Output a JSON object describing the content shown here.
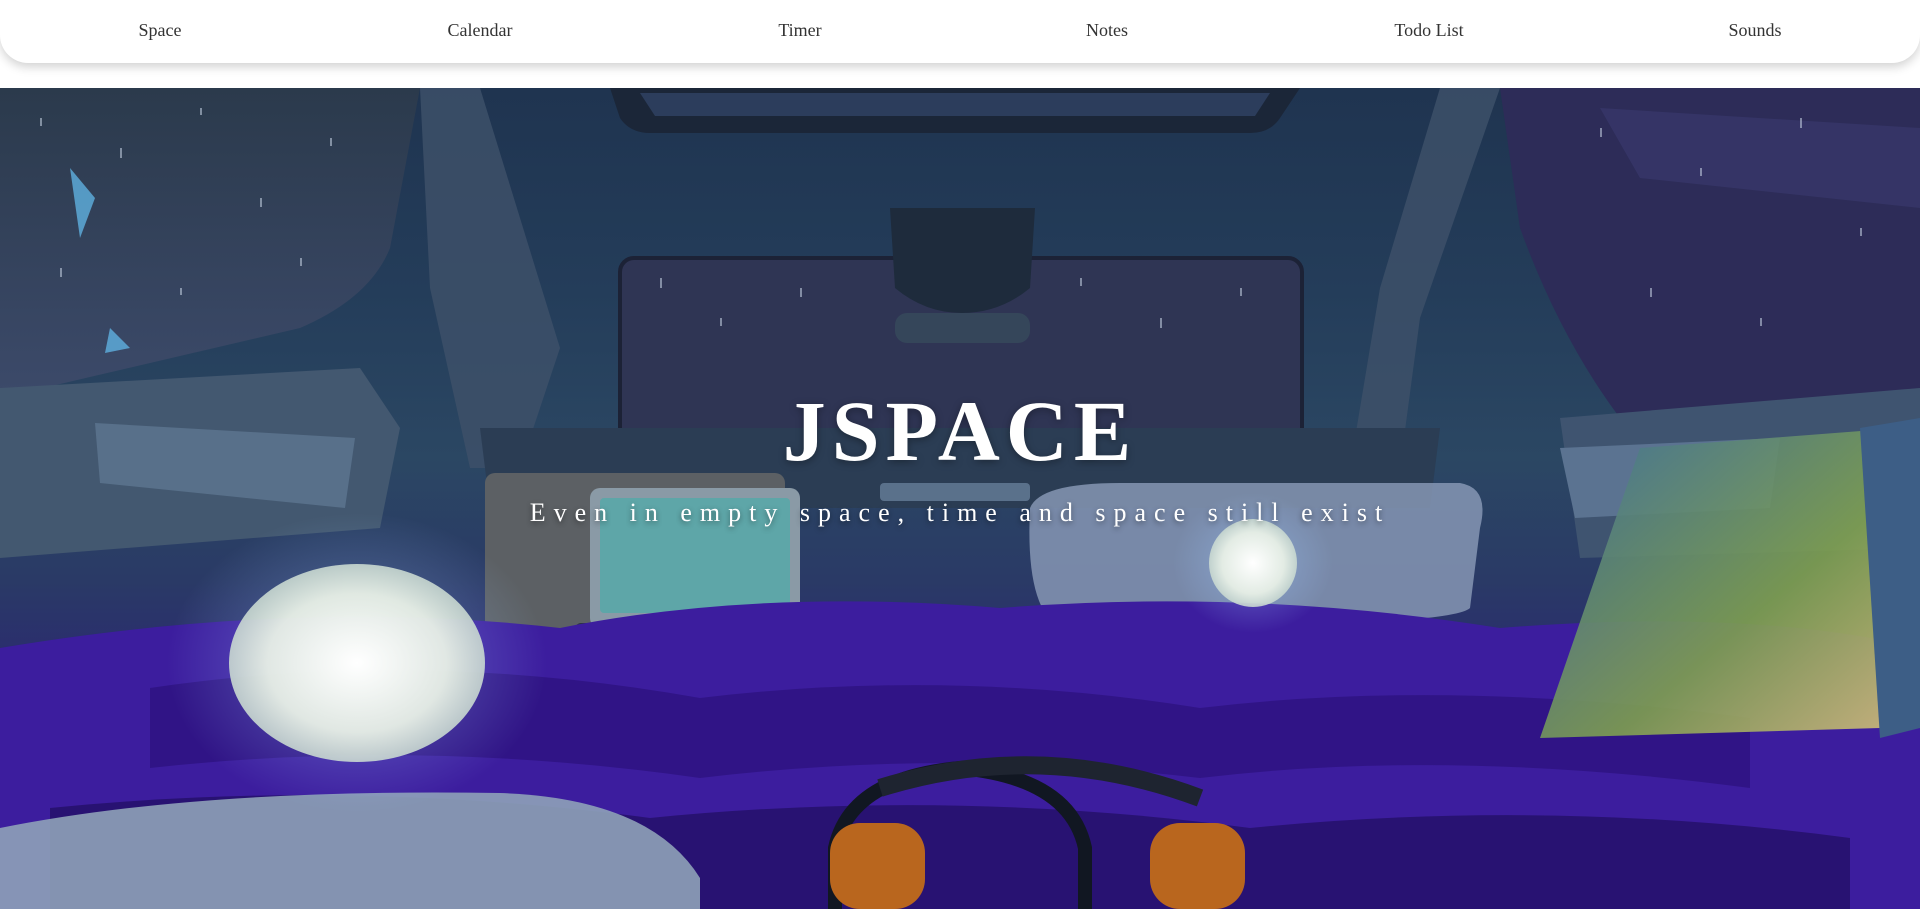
{
  "nav": {
    "items": [
      {
        "label": "Space"
      },
      {
        "label": "Calendar"
      },
      {
        "label": "Timer"
      },
      {
        "label": "Notes"
      },
      {
        "label": "Todo List"
      },
      {
        "label": "Sounds"
      }
    ]
  },
  "hero": {
    "title": "JSPACE",
    "subtitle": "Even in empty space, time and space still exist",
    "background_image": "car-interior-night-rain-scene"
  },
  "colors": {
    "nav_background": "#ffffff",
    "nav_text": "#333333",
    "hero_text": "#ffffff",
    "accent_purple": "#3a2190"
  }
}
